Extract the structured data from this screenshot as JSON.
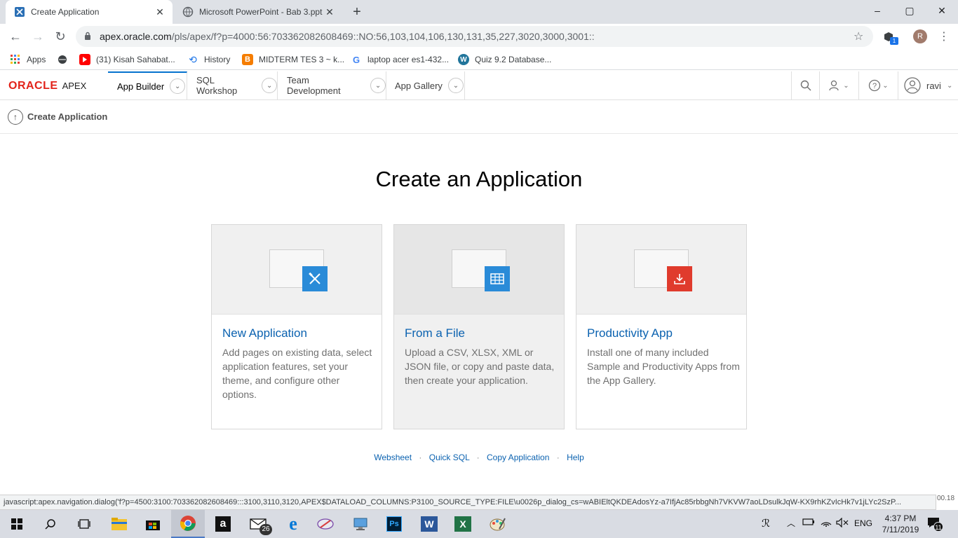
{
  "browser": {
    "tabs": [
      {
        "title": "Create Application",
        "active": true
      },
      {
        "title": "Microsoft PowerPoint - Bab 3.ppt",
        "active": false
      }
    ],
    "new_tab_label": "+",
    "window_controls": {
      "minimize": "–",
      "maximize": "▢",
      "close": "✕"
    },
    "url_host": "apex.oracle.com",
    "url_path": "/pls/apex/f?p=4000:56:703362082608469::NO:56,103,104,106,130,131,35,227,3020,3000,3001::",
    "profile_initial": "R",
    "extension_badge": "1",
    "bookmarks": [
      {
        "label": "Apps",
        "icon": "apps-grid-icon"
      },
      {
        "label": "",
        "icon": "globe-icon"
      },
      {
        "label": "(31) Kisah Sahabat...",
        "icon": "youtube-icon"
      },
      {
        "label": "History",
        "icon": "history-icon"
      },
      {
        "label": "MIDTERM TES 3 ~ k...",
        "icon": "blogger-icon"
      },
      {
        "label": "laptop acer es1-432...",
        "icon": "google-icon"
      },
      {
        "label": "Quiz 9.2 Database...",
        "icon": "wordpress-icon"
      }
    ]
  },
  "apex": {
    "logo_oracle": "ORACLE",
    "logo_apex": "APEX",
    "nav": [
      {
        "label": "App Builder",
        "active": true
      },
      {
        "label": "SQL Workshop",
        "active": false
      },
      {
        "label": "Team Development",
        "active": false
      },
      {
        "label": "App Gallery",
        "active": false
      }
    ],
    "user": "ravi",
    "breadcrumb": "Create Application",
    "page_title": "Create an Application",
    "cards": [
      {
        "title": "New Application",
        "desc": "Add pages on existing data, select application features, set your theme, and configure other options.",
        "icon": "tools-icon",
        "color": "#2a8bd8"
      },
      {
        "title": "From a File",
        "desc": "Upload a CSV, XLSX, XML or JSON file, or copy and paste data, then create your application.",
        "icon": "table-icon",
        "color": "#2a8bd8"
      },
      {
        "title": "Productivity App",
        "desc": "Install one of many included Sample and Productivity Apps from the App Gallery.",
        "icon": "download-icon",
        "color": "#e03b2d"
      }
    ],
    "footer_links": [
      "Websheet",
      "Quick SQL",
      "Copy Application",
      "Help"
    ],
    "footer_sep": "·"
  },
  "status_url": "javascript:apex.navigation.dialog('f?p=4500:3100:703362082608469:::3100,3110,3120,APEX$DATALOAD_COLUMNS:P3100_SOURCE_TYPE:FILE\\u0026p_dialog_cs=wABIEltQKDEAdosYz-a7IfjAc85rbbgNh7VKVW7aoLDsulkJqW-KX9rhKZvIcHk7v1jLYc2SzP...",
  "status_fragment": "00.18",
  "taskbar": {
    "mail_badge": "26",
    "lang": "ENG",
    "time": "4:37 PM",
    "date": "7/11/2019",
    "notify_count": "11"
  }
}
